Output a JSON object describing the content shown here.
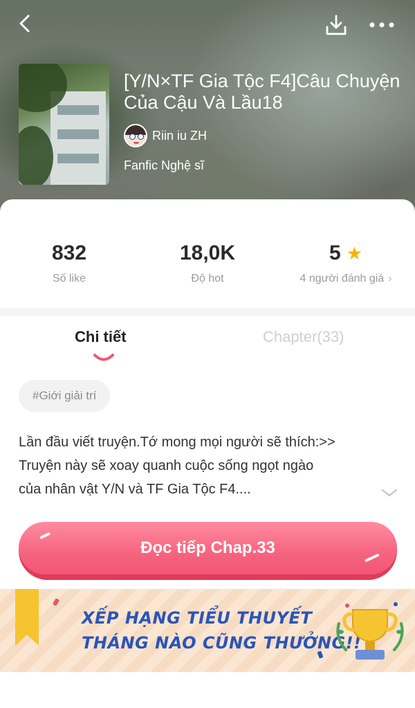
{
  "header": {
    "story_title": "[Y/N×TF Gia Tộc F4]Câu Chuyện Của Cậu Và Lầu18",
    "author_name": "Riin iu ZH",
    "genre": "Fanfic Nghệ sĩ",
    "icons": [
      "back-arrow-icon",
      "download-icon",
      "more-dots-icon"
    ]
  },
  "stats": {
    "likes": {
      "value": "832",
      "label": "Số like"
    },
    "hot": {
      "value": "18,0K",
      "label": "Độ hot"
    },
    "rating": {
      "value": "5",
      "label": "4 người đánh giá",
      "star_color": "#f7b500"
    }
  },
  "tabs": [
    {
      "label": "Chi tiết",
      "active": true
    },
    {
      "label": "Chapter(33)",
      "active": false
    }
  ],
  "tag": "#Giới giải trí",
  "description": {
    "line1": "Lần đầu viết truyện.Tớ mong mọi người sẽ thích:>>",
    "line2": "Truyện này sẽ xoay quanh cuộc sống ngọt ngào",
    "line3": "của nhân vật Y/N và TF Gia Tộc F4...."
  },
  "cta": {
    "label": "Đọc tiếp Chap.33",
    "color": "#f6647f"
  },
  "banner": {
    "line1": "XẾP HẠNG TIỂU THUYẾT",
    "line2": "THÁNG NÀO CŨNG THƯỞNG!!",
    "text_color": "#2a55b8"
  },
  "colors": {
    "accent": "#f05675",
    "tab_indicator": "#f05675"
  }
}
